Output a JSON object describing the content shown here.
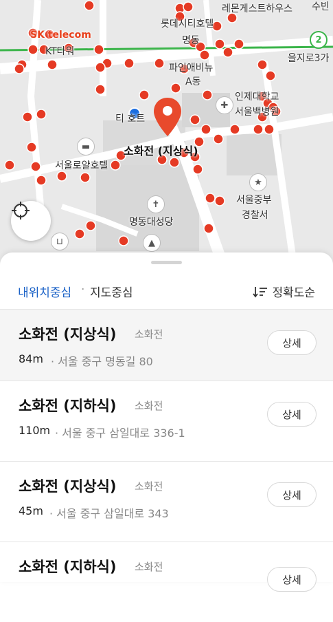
{
  "map": {
    "labels": {
      "lemon_guesthouse": "레몬게스트하우스",
      "suwon": "수빈",
      "lotte_hotel": "롯데시티호텔",
      "myeongdong": "명동",
      "sk_telecom": "SK telecom",
      "kt_tower": "KT타워",
      "euljiro3ga": "을지로3가",
      "line_number": "2",
      "pine_avenue": "파인애비뉴",
      "a_dong": "A동",
      "inje_univ": "인제대학교",
      "seoul_paik": "서울백병원",
      "tim_hortons": "티 호트",
      "selected_place": "소화전 (지상식)",
      "royal_hotel": "서울로얄호텔",
      "police_station_1": "서울중부",
      "police_station_2": "경찰서",
      "cathedral": "명동대성당"
    },
    "colors": {
      "pin": "#e84a2c",
      "hydrant": "#e53a24",
      "line2": "#3bb54a",
      "road": "#ffffff",
      "block": "#dcdcdc"
    }
  },
  "filter": {
    "my_location": "내위치중심",
    "map_center": "지도중심",
    "sort_label": "정확도순"
  },
  "results": [
    {
      "title": "소화전 (지상식)",
      "category": "소화전",
      "distance": "84m",
      "address": "서울 중구 명동길 80",
      "button": "상세"
    },
    {
      "title": "소화전 (지하식)",
      "category": "소화전",
      "distance": "110m",
      "address": "서울 중구 삼일대로 336-1",
      "button": "상세"
    },
    {
      "title": "소화전 (지상식)",
      "category": "소화전",
      "distance": "45m",
      "address": "서울 중구 삼일대로 343",
      "button": "상세"
    },
    {
      "title": "소화전 (지하식)",
      "category": "소화전",
      "distance": "",
      "address": "",
      "button": "상세"
    }
  ]
}
